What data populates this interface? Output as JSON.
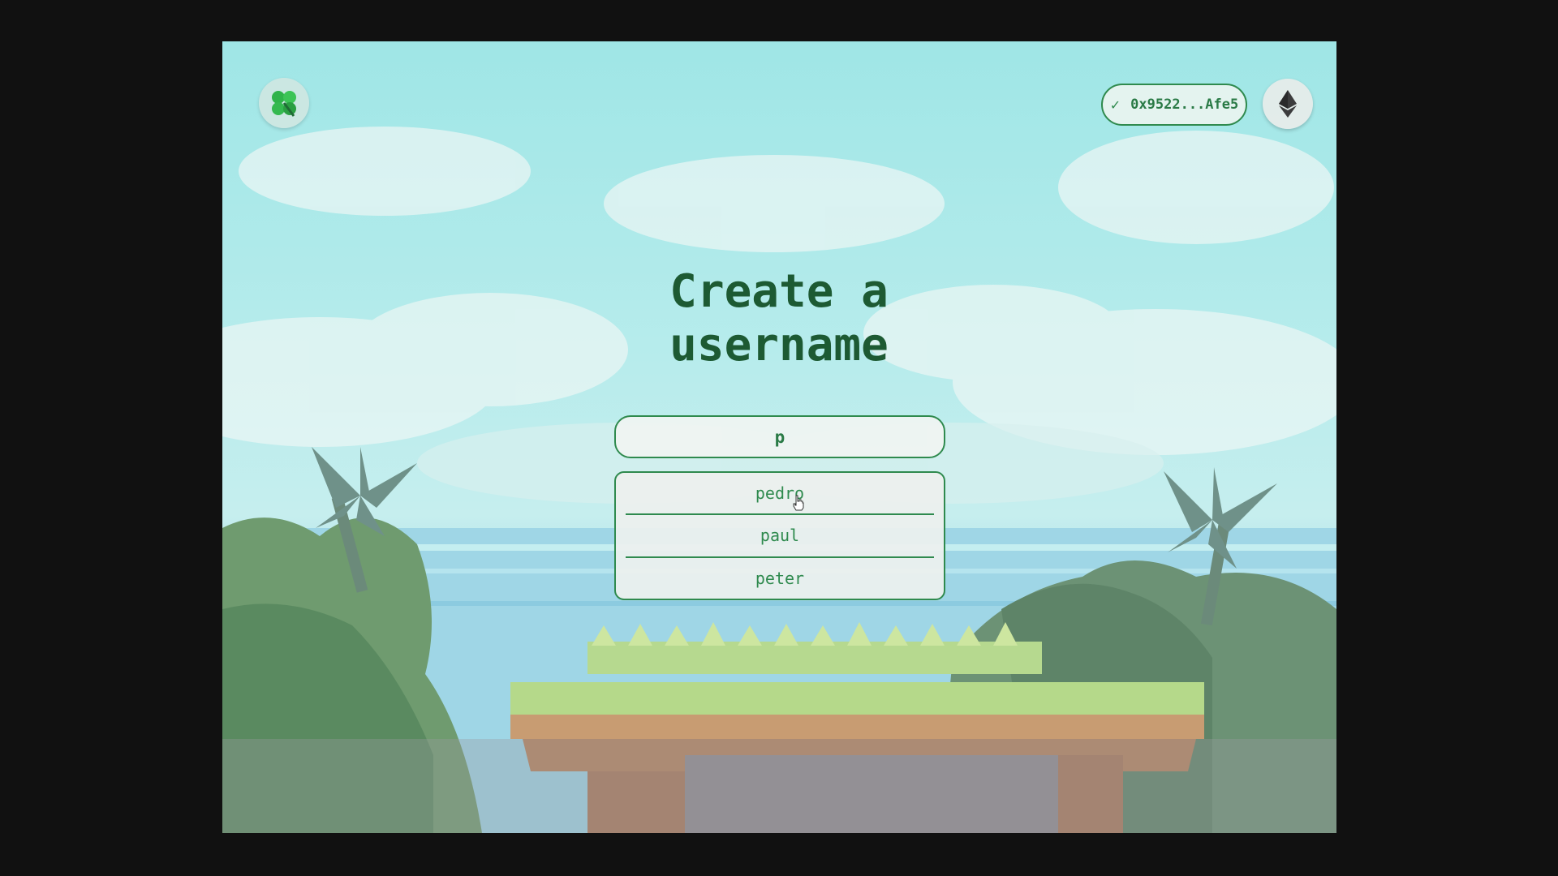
{
  "header": {
    "logo_icon": "clover-logo-icon",
    "wallet": {
      "status_icon": "check-icon",
      "address": "0x9522...Afe5"
    },
    "network_icon": "ethereum-icon"
  },
  "main": {
    "title_line1": "Create a",
    "title_line2": "username",
    "input": {
      "value": "p"
    },
    "suggestions": [
      "pedro",
      "paul",
      "peter"
    ]
  },
  "colors": {
    "accent": "#2f8a4e",
    "title": "#1d5a33",
    "frame": "#111111"
  }
}
